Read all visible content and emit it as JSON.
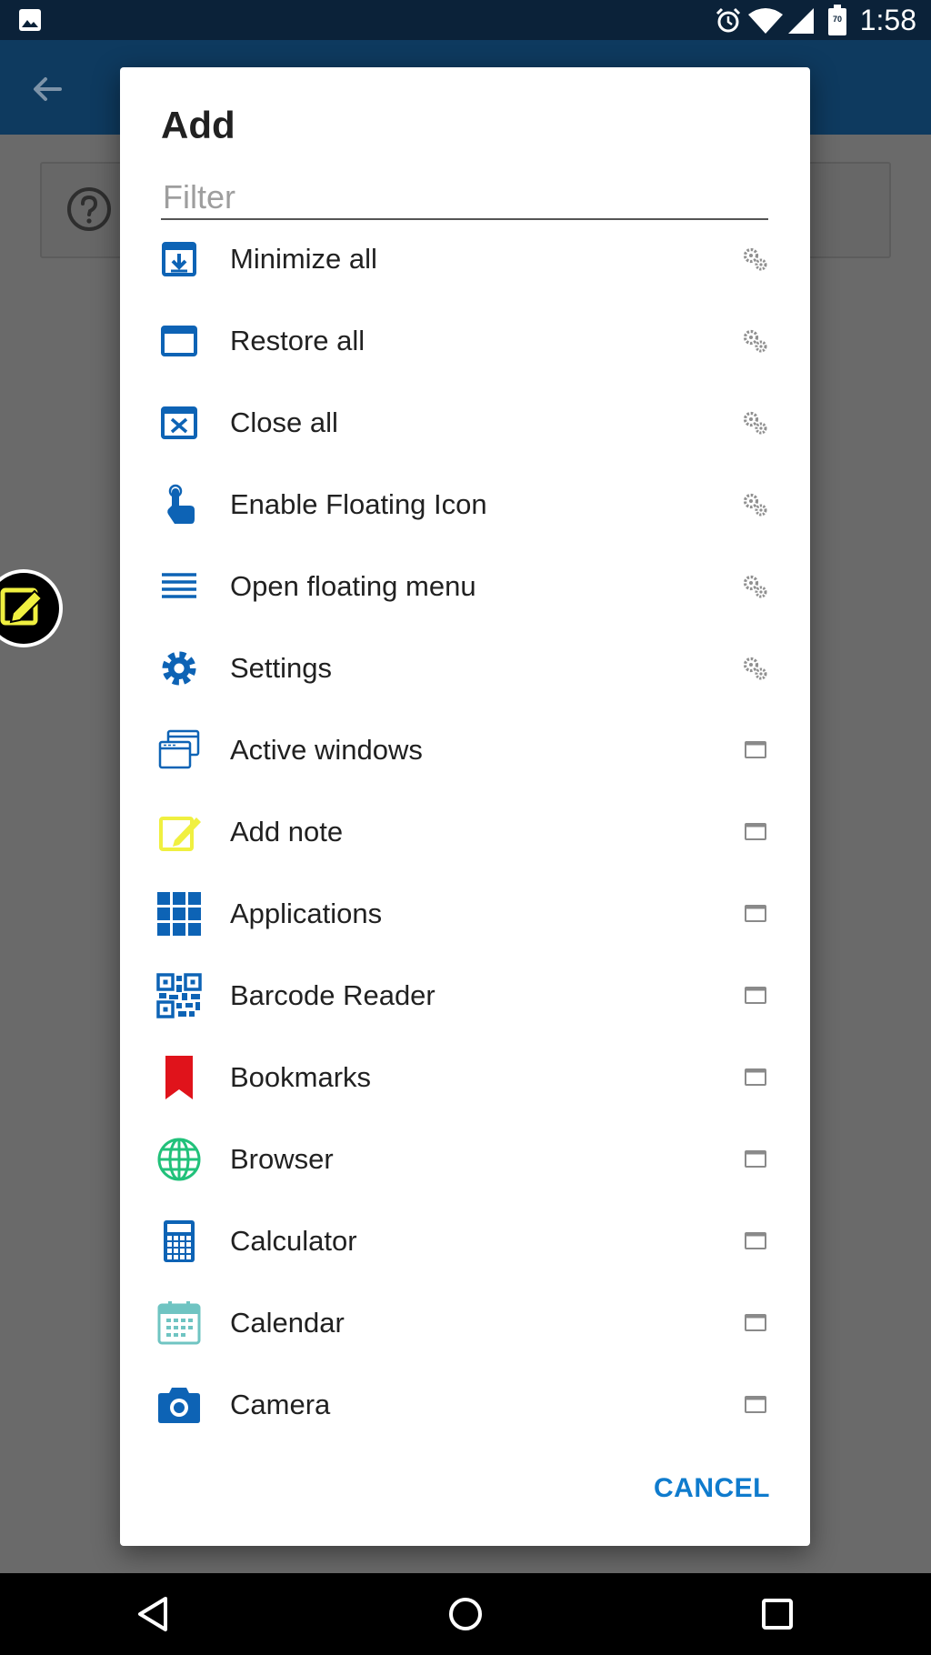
{
  "status_bar": {
    "time": "1:58",
    "icons": [
      "image-icon",
      "alarm-icon",
      "wifi-icon",
      "signal-icon",
      "battery-icon"
    ],
    "battery_level": "70"
  },
  "app_bar": {
    "back_icon": "arrow-back-icon"
  },
  "background": {
    "help_icon": "help-circle-icon"
  },
  "dialog": {
    "title": "Add",
    "filter_placeholder": "Filter",
    "filter_value": "",
    "items": [
      {
        "label": "Minimize all",
        "icon": "minimize-all-icon",
        "type_icon": "gears-icon"
      },
      {
        "label": "Restore all",
        "icon": "restore-all-icon",
        "type_icon": "gears-icon"
      },
      {
        "label": "Close all",
        "icon": "close-all-icon",
        "type_icon": "gears-icon"
      },
      {
        "label": "Enable Floating Icon",
        "icon": "touch-icon",
        "type_icon": "gears-icon"
      },
      {
        "label": "Open floating menu",
        "icon": "menu-lines-icon",
        "type_icon": "gears-icon"
      },
      {
        "label": "Settings",
        "icon": "settings-gear-icon",
        "type_icon": "gears-icon"
      },
      {
        "label": "Active windows",
        "icon": "active-windows-icon",
        "type_icon": "window-icon"
      },
      {
        "label": "Add note",
        "icon": "add-note-icon",
        "type_icon": "window-icon"
      },
      {
        "label": "Applications",
        "icon": "applications-grid-icon",
        "type_icon": "window-icon"
      },
      {
        "label": "Barcode Reader",
        "icon": "qr-code-icon",
        "type_icon": "window-icon"
      },
      {
        "label": "Bookmarks",
        "icon": "bookmark-icon",
        "type_icon": "window-icon"
      },
      {
        "label": "Browser",
        "icon": "globe-icon",
        "type_icon": "window-icon"
      },
      {
        "label": "Calculator",
        "icon": "calculator-icon",
        "type_icon": "window-icon"
      },
      {
        "label": "Calendar",
        "icon": "calendar-icon",
        "type_icon": "window-icon"
      },
      {
        "label": "Camera",
        "icon": "camera-icon",
        "type_icon": "window-icon"
      }
    ],
    "cancel_label": "CANCEL"
  },
  "nav_bar": {
    "back": "nav-back-icon",
    "home": "nav-home-icon",
    "recents": "nav-recents-icon"
  },
  "colors": {
    "accent": "#0f7bcd",
    "icon_blue": "#0d63b5",
    "status_bar": "#0b2239",
    "app_bar": "#0e3a5f",
    "bookmark_red": "#e0131b",
    "note_yellow": "#f0f040",
    "globe_green": "#21c17a",
    "calendar_teal": "#6fc4c2"
  }
}
